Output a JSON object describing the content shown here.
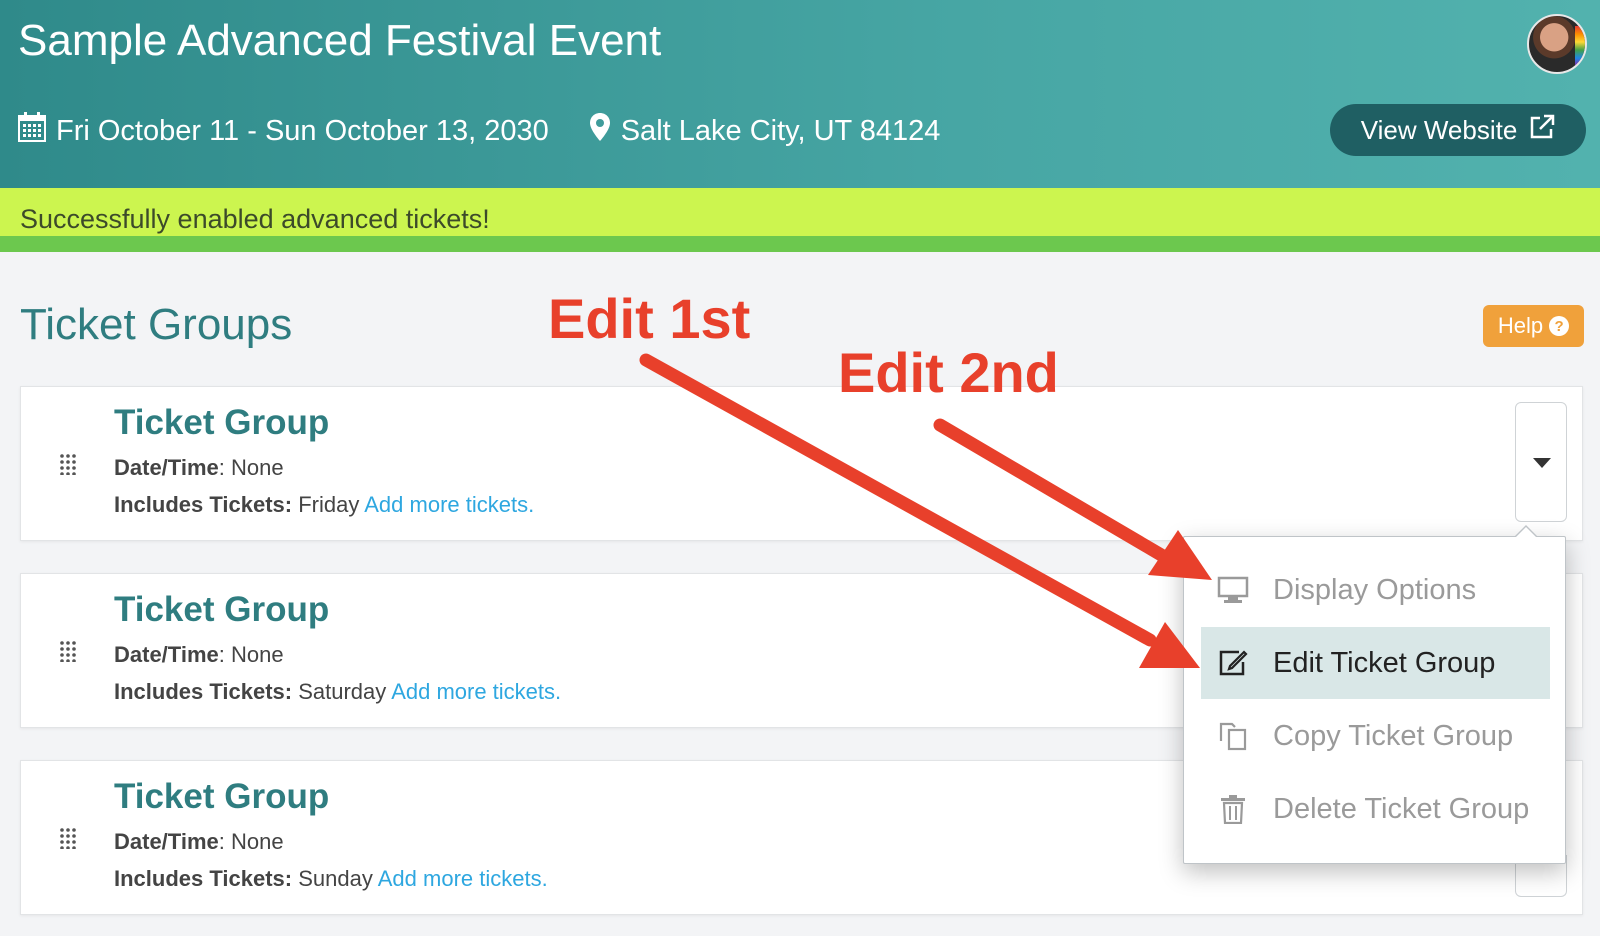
{
  "header": {
    "event_title": "Sample Advanced Festival Event",
    "dates": "Fri October 11 - Sun October 13, 2030",
    "location": "Salt Lake City, UT 84124",
    "view_website_label": "View Website"
  },
  "alert": {
    "message": "Successfully enabled advanced tickets!"
  },
  "section": {
    "title": "Ticket Groups",
    "help_label": "Help"
  },
  "ticket_groups": [
    {
      "title": "Ticket Group",
      "datetime_label": "Date/Time",
      "datetime_value": ": None",
      "includes_label": "Includes Tickets:",
      "includes_value": " Friday ",
      "add_link": "Add more tickets."
    },
    {
      "title": "Ticket Group",
      "datetime_label": "Date/Time",
      "datetime_value": ": None",
      "includes_label": "Includes Tickets:",
      "includes_value": " Saturday ",
      "add_link": "Add more tickets."
    },
    {
      "title": "Ticket Group",
      "datetime_label": "Date/Time",
      "datetime_value": ": None",
      "includes_label": "Includes Tickets:",
      "includes_value": " Sunday ",
      "add_link": "Add more tickets."
    }
  ],
  "dropdown": {
    "items": [
      {
        "label": "Display Options",
        "icon": "monitor-icon"
      },
      {
        "label": "Edit Ticket Group",
        "icon": "edit-icon",
        "active": true
      },
      {
        "label": "Copy Ticket Group",
        "icon": "copy-icon"
      },
      {
        "label": "Delete Ticket Group",
        "icon": "trash-icon"
      }
    ]
  },
  "annotations": {
    "first": "Edit 1st",
    "second": "Edit 2nd",
    "color": "#e8402b"
  },
  "colors": {
    "header_teal": "#47a6a4",
    "alert_green": "#ccf54f",
    "title_teal": "#2f7d80",
    "link_blue": "#2ea7e0",
    "help_orange": "#f0a13b"
  }
}
